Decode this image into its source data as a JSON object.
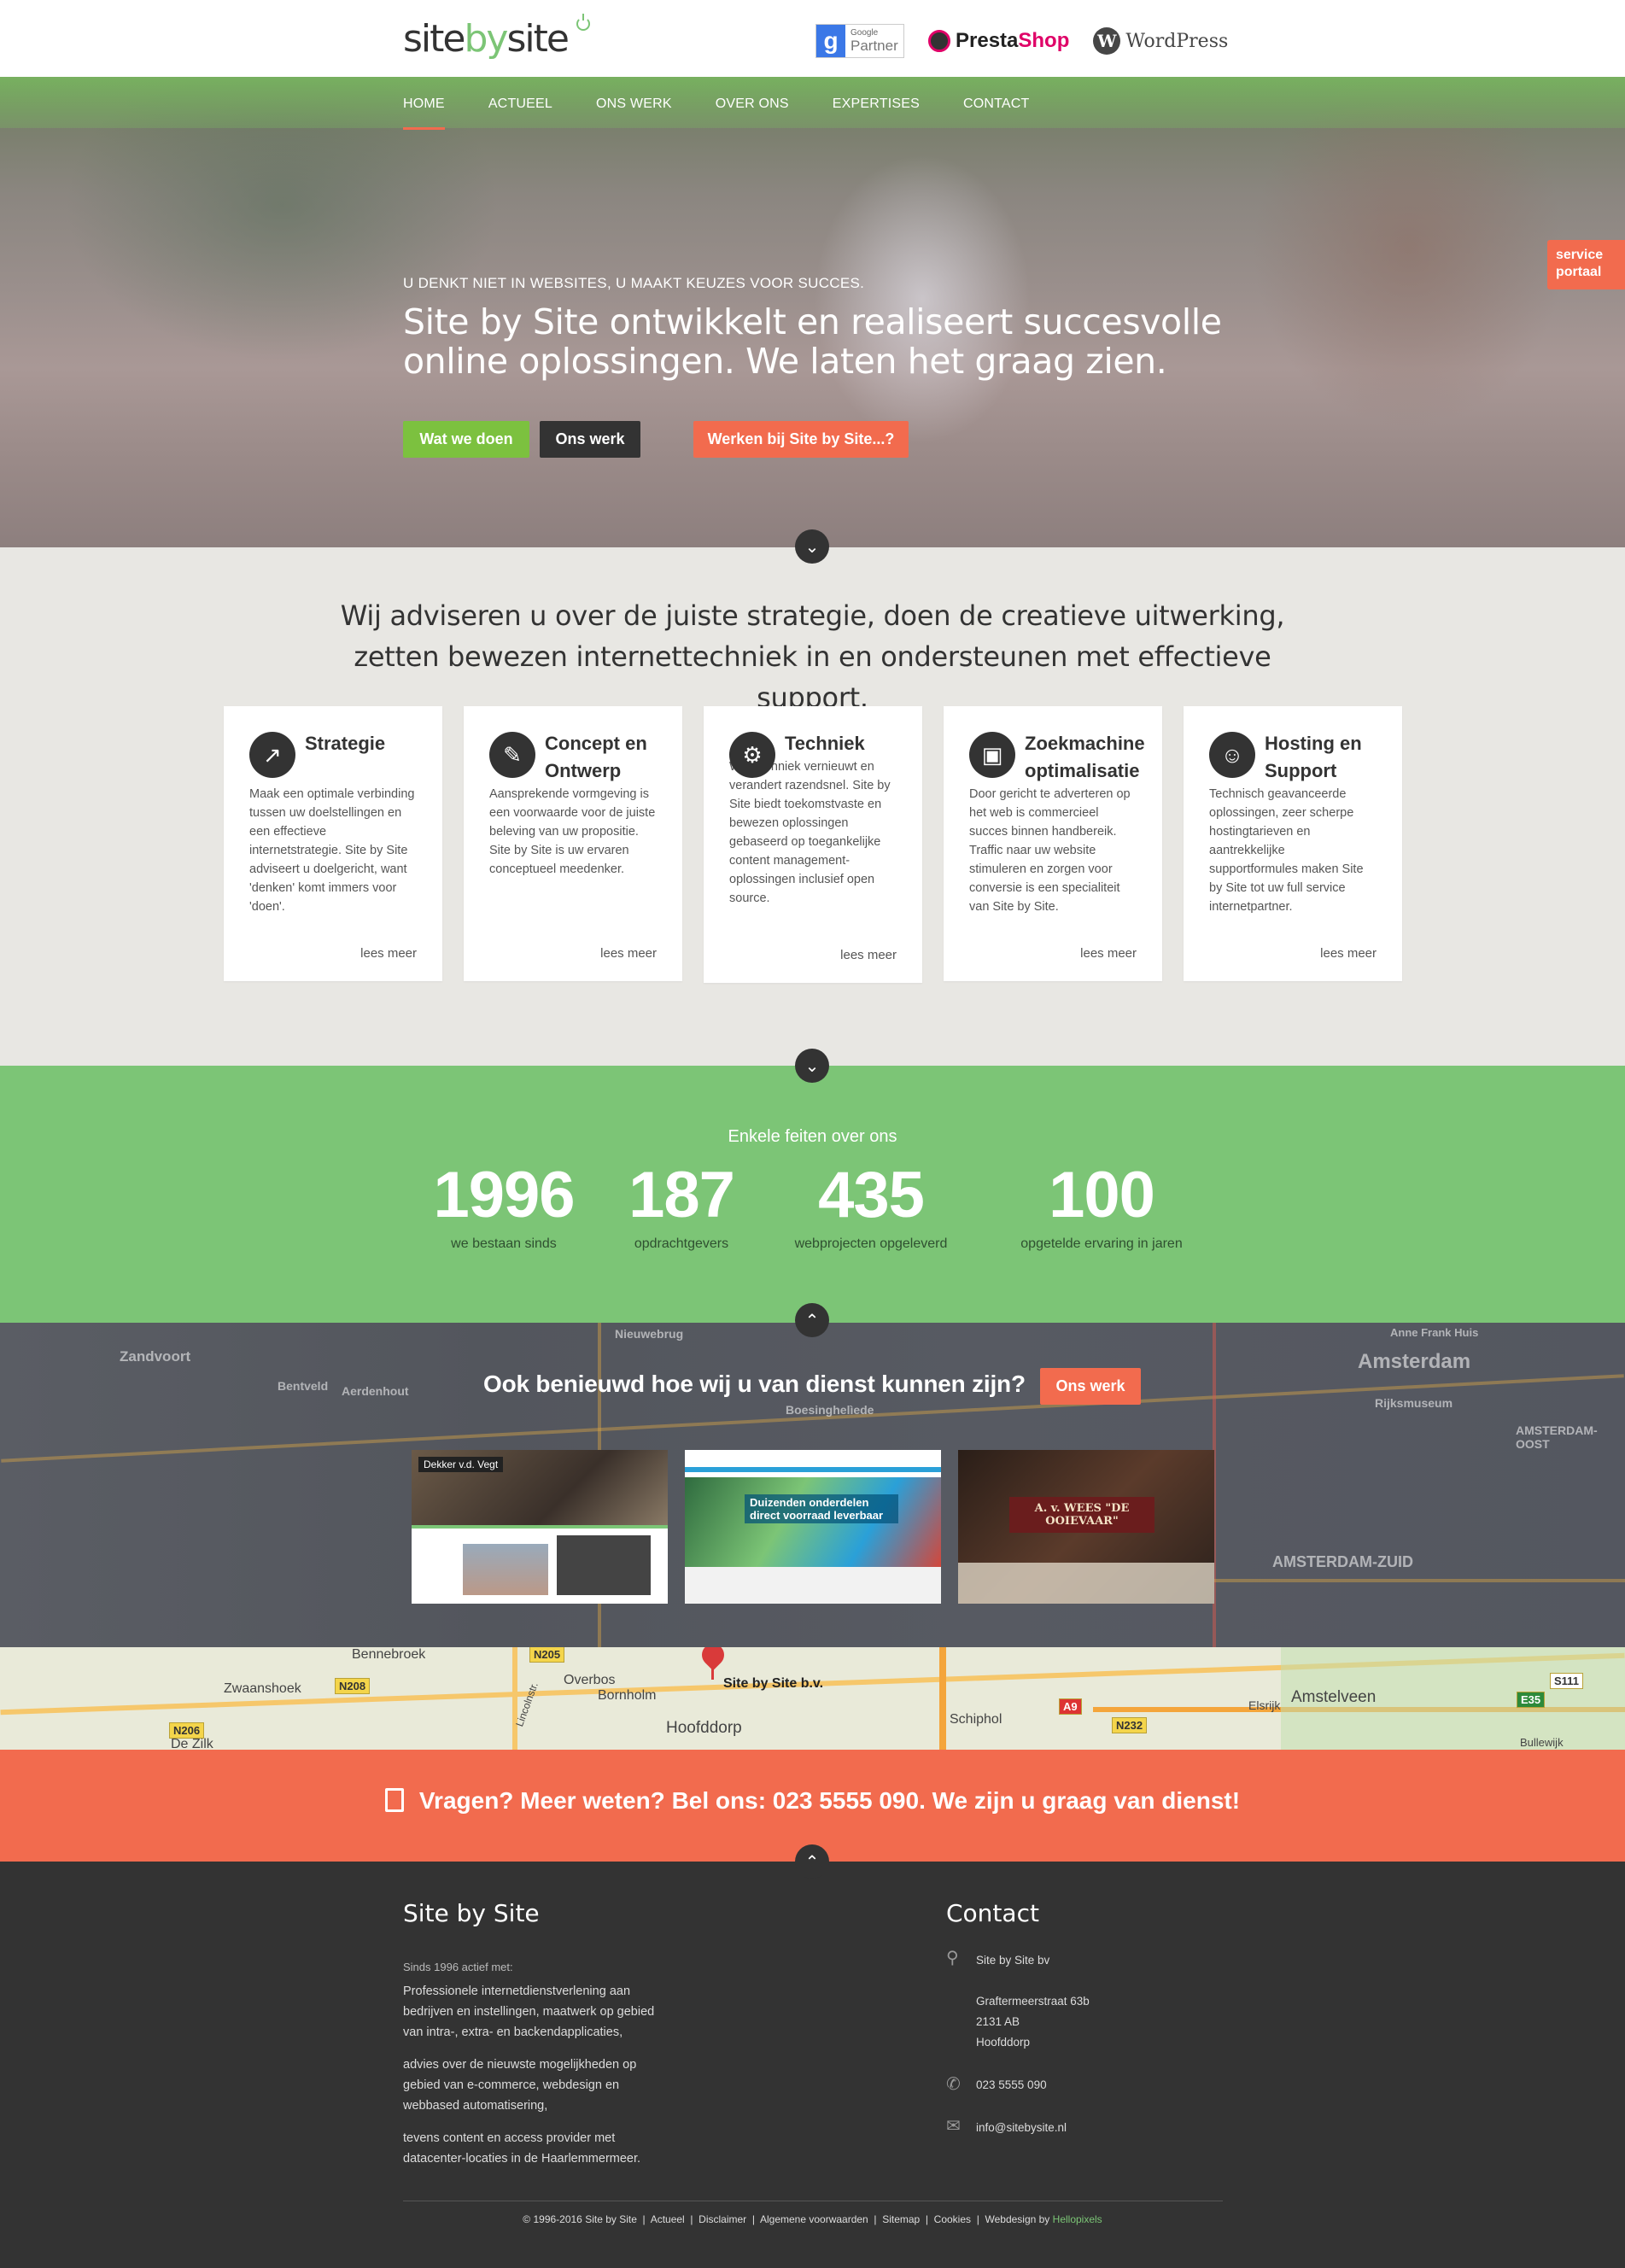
{
  "logo": {
    "text_site": "site",
    "text_by": "by",
    "text_site2": "site"
  },
  "partners": {
    "google_small": "Google",
    "google_label": "Partner",
    "prestashop_a": "Presta",
    "prestashop_b": "Shop",
    "wordpress": "WordPress"
  },
  "nav": [
    "HOME",
    "ACTUEEL",
    "ONS WERK",
    "OVER ONS",
    "EXPERTISES",
    "CONTACT"
  ],
  "hero": {
    "kicker": "U DENKT NIET IN WEBSITES, U MAAKT KEUZES VOOR SUCCES.",
    "headline": "Site by Site ontwikkelt en realiseert succesvolle online oplossingen. We laten het graag zien.",
    "btn_primary": "Wat we doen",
    "btn_secondary": "Ons werk",
    "btn_jobs": "Werken bij Site by Site...?"
  },
  "service_tab": "service portaal",
  "intro": "Wij adviseren u over de juiste strategie, doen de creatieve uitwerking, zetten bewezen internettechniek in en ondersteunen met effectieve support.",
  "services": [
    {
      "title": "Strategie",
      "icon": "presentation-chart-icon",
      "text": "Maak een optimale verbinding tussen uw doelstellingen en een effectieve internetstrategie. Site by Site adviseert u doelgericht, want 'denken' komt immers voor 'doen'.",
      "more": "lees meer"
    },
    {
      "title": "Concept en Ontwerp",
      "icon": "pencil-ruler-icon",
      "text": "Aansprekende vormgeving is een voorwaarde voor de juiste beleving van uw propositie.\nSite by Site is uw ervaren conceptueel meedenker.",
      "more": "lees meer"
    },
    {
      "title": "Techniek",
      "icon": "gear-icon",
      "text": "Webtechniek vernieuwt en verandert razendsnel. Site by Site biedt toekomstvaste en bewezen oplossingen gebaseerd op toegankelijke content management-oplossingen inclusief open source.",
      "more": "lees meer"
    },
    {
      "title": "Zoekmachine optimalisatie",
      "icon": "monitor-chart-icon",
      "text": "Door gericht te adverteren op het web is commercieel succes binnen handbereik. Traffic naar uw website stimuleren en zorgen voor conversie is een specialiteit van Site by Site.",
      "more": "lees meer"
    },
    {
      "title": "Hosting en Support",
      "icon": "people-icon",
      "text": "Technisch geavanceerde oplossingen, zeer scherpe hostingtarieven en aantrekkelijke supportformules maken Site by Site tot uw full service internetpartner.",
      "more": "lees meer"
    }
  ],
  "facts": {
    "title": "Enkele feiten over ons",
    "items": [
      {
        "number": "1996",
        "label": "we bestaan sinds"
      },
      {
        "number": "187",
        "label": "opdrachtgevers"
      },
      {
        "number": "435",
        "label": "webprojecten opgeleverd"
      },
      {
        "number": "100",
        "label": "opgetelde ervaring in jaren"
      }
    ]
  },
  "work": {
    "question": "Ook benieuwd hoe wij u van dienst kunnen zijn?",
    "button": "Ons werk",
    "thumbs": [
      {
        "caption": "Dekker v.d. Vegt"
      },
      {
        "caption": "Duizenden onderdelen direct voorraad leverbaar"
      },
      {
        "caption": "A. v. WEES \"DE OOIEVAAR\""
      }
    ],
    "map_labels": [
      "Zandvoort",
      "Aerdenhout",
      "Bentveld",
      "Nieuwebrug",
      "Boesinghelìede",
      "Amsterdam",
      "Rijksmuseum",
      "AMSTERDAM-OOST",
      "AMSTERDAM-ZUID",
      "Anne Frank Huis"
    ]
  },
  "map": {
    "pin_label": "Site by Site b.v.",
    "places": [
      "Bennebroek",
      "Zwaanshoek",
      "Overbos",
      "Bornholm",
      "Hoofddorp",
      "Schiphol",
      "Amstelveen",
      "Elsrijk",
      "Bullewijk",
      "De Zilk",
      "Lincolnstr."
    ],
    "roads": [
      "N208",
      "N205",
      "N206",
      "N232",
      "A9",
      "E35",
      "S111"
    ]
  },
  "call": {
    "text": "Vragen? Meer weten? Bel ons: 023 5555 090. We zijn u graag van dienst!"
  },
  "footer": {
    "left_title": "Site by Site",
    "since": "Sinds 1996 actief met:",
    "p1": "Professionele internetdienstverlening aan bedrijven en instellingen, maatwerk op gebied van intra-, extra- en backendapplicaties,",
    "p2": "advies over de nieuwste mogelijkheden op gebied van e-commerce, webdesign en webbased automatisering,",
    "p3": "tevens content en access provider met datacenter-locaties in de Haarlemmermeer.",
    "right_title": "Contact",
    "company": "Site by Site bv",
    "street": "Graftermeerstraat 63b",
    "zip": "2131 AB",
    "city": "Hoofddorp",
    "phone": "023 5555 090",
    "email": "info@sitebysite.nl",
    "copyright": "© 1996-2016 Site by Site",
    "links": [
      "Actueel",
      "Disclaimer",
      "Algemene voorwaarden",
      "Sitemap",
      "Cookies"
    ],
    "webdesign_by": "Webdesign by",
    "webdesign_name": "Hellopixels"
  },
  "colors": {
    "green": "#7cc576",
    "orange": "#f26b4e",
    "dark": "#333333",
    "light": "#e8e7e3"
  }
}
